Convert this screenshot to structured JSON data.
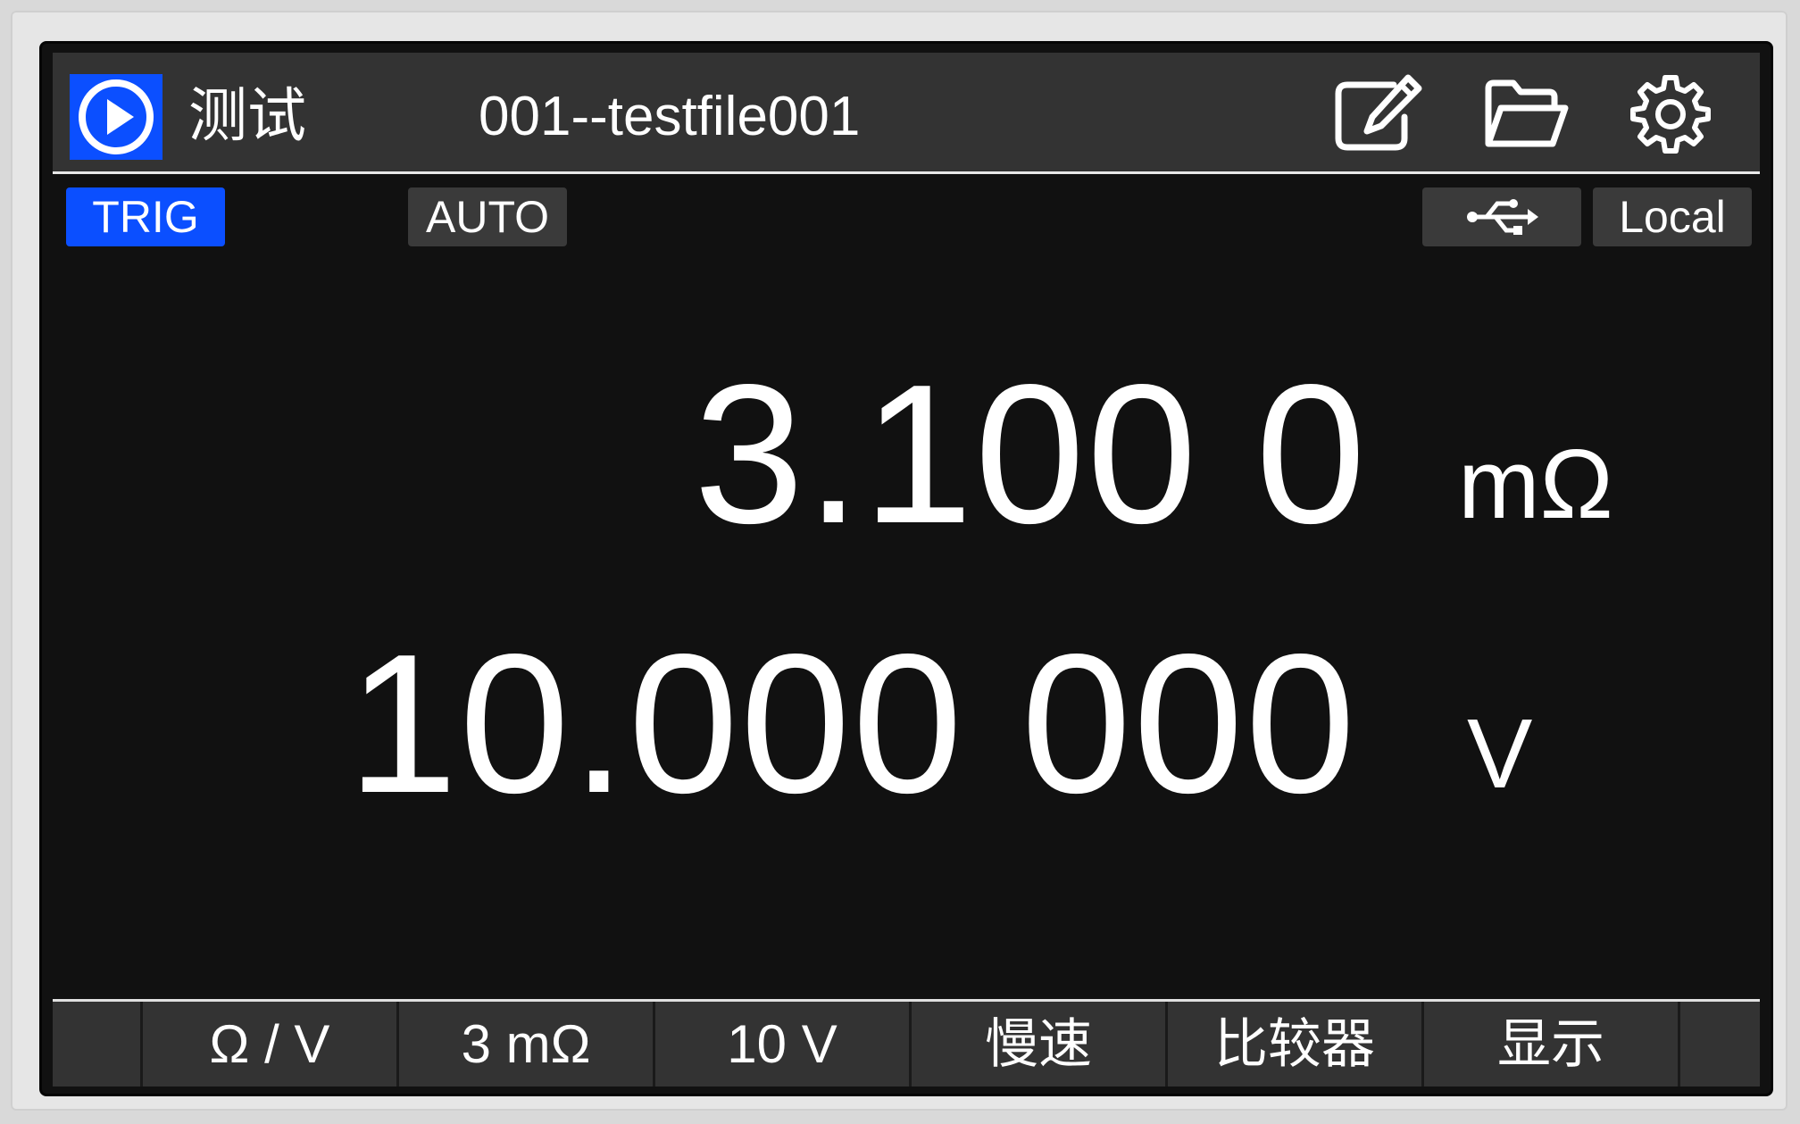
{
  "header": {
    "title": "测试",
    "file_name": "001--testfile001",
    "icons": [
      "play-icon",
      "edit-icon",
      "folder-open-icon",
      "gear-icon"
    ],
    "accent_color": "#0b4fff"
  },
  "status": {
    "trig_label": "TRIG",
    "auto_label": "AUTO",
    "usb_icon": "usb-icon",
    "local_label": "Local"
  },
  "readings": {
    "resistance": {
      "value": "3.100 0",
      "unit": "mΩ"
    },
    "voltage": {
      "value": "10.000 000",
      "unit": "V"
    }
  },
  "softkeys": [
    {
      "label": ""
    },
    {
      "label": "Ω / V"
    },
    {
      "label": "3 mΩ"
    },
    {
      "label": "10 V"
    },
    {
      "label": "慢速"
    },
    {
      "label": "比较器"
    },
    {
      "label": "显示"
    },
    {
      "label": ""
    }
  ]
}
